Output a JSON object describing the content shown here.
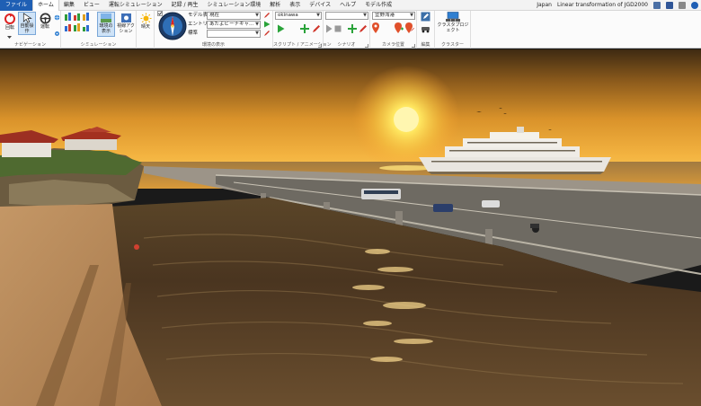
{
  "menu": {
    "items": [
      "ファイル",
      "ホーム",
      "編集",
      "ビュー",
      "運転シミュレーション",
      "記録 / 再生",
      "シミュレーション環境",
      "解析",
      "表示",
      "デバイス",
      "ヘルプ",
      "モデル作成"
    ],
    "active_index": 1,
    "region": "Japan",
    "coordinate_system": "Linear transformation of JGD2000"
  },
  "ribbon": {
    "navigation": {
      "label": "ナビゲーション",
      "rotate": "回転",
      "auto_operation": "自動操作",
      "drive": "運転"
    },
    "simulation": {
      "label": "シミュレーション",
      "display_env": "環境の表示",
      "view_anim": "視線アクション"
    },
    "weather": {
      "label": "晴天"
    },
    "environment": {
      "label": "環境の表示",
      "model_label": "モデル表示",
      "model_value": "現在",
      "entry_label": "エントリ",
      "entry_value": "あたよビーチキャ...",
      "standard_label": "標準",
      "standard_value": ""
    },
    "script": {
      "label": "スクリプト / アニメーション",
      "value": "okinawa"
    },
    "scene": {
      "label": "シナリオ",
      "value": ""
    },
    "camera": {
      "label": "カメラ位置",
      "value": "宜野湾港"
    },
    "edit": {
      "label": "編集"
    },
    "cluster": {
      "label": "クラスター",
      "button": "クラスタプロジェクト"
    }
  }
}
